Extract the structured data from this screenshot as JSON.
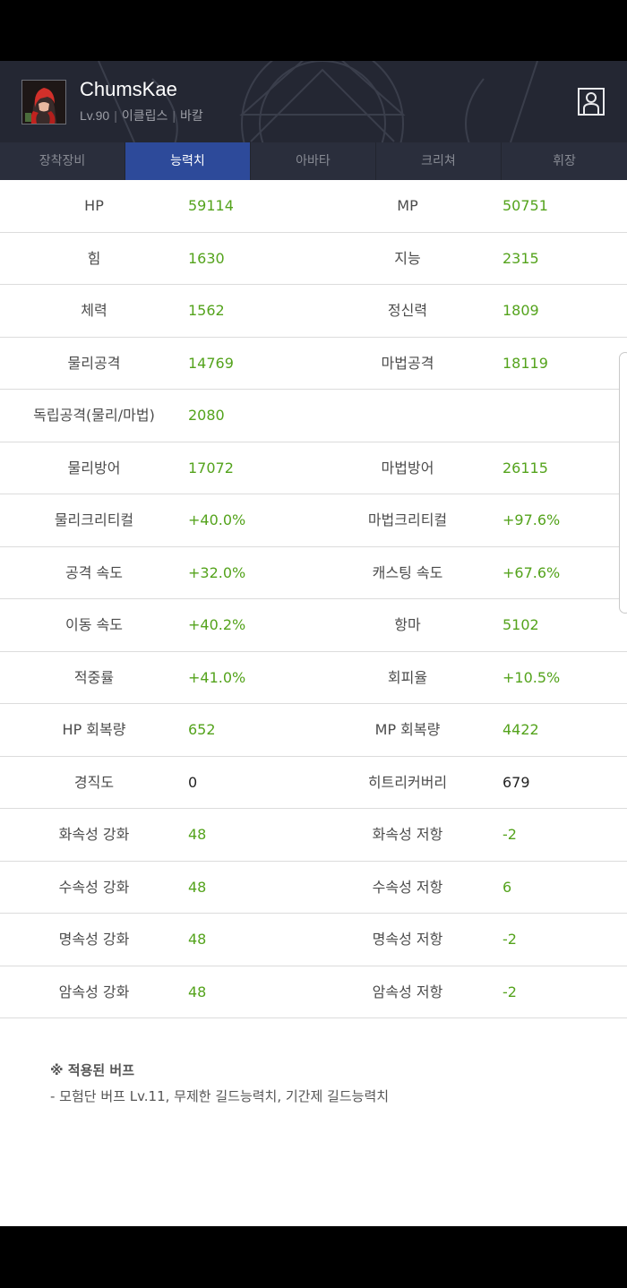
{
  "character": {
    "name": "ChumsKae",
    "level": "Lv.90",
    "job": "이클립스",
    "server": "바칼",
    "separator": "|"
  },
  "tabs": [
    {
      "label": "장착장비",
      "active": false
    },
    {
      "label": "능력치",
      "active": true
    },
    {
      "label": "아바타",
      "active": false
    },
    {
      "label": "크리쳐",
      "active": false
    },
    {
      "label": "휘장",
      "active": false
    }
  ],
  "stats": [
    {
      "left_label": "HP",
      "left_value": "59114",
      "right_label": "MP",
      "right_value": "50751"
    },
    {
      "left_label": "힘",
      "left_value": "1630",
      "right_label": "지능",
      "right_value": "2315"
    },
    {
      "left_label": "체력",
      "left_value": "1562",
      "right_label": "정신력",
      "right_value": "1809"
    },
    {
      "left_label": "물리공격",
      "left_value": "14769",
      "right_label": "마법공격",
      "right_value": "18119"
    },
    {
      "left_label": "독립공격(물리/마법)",
      "left_value": "2080",
      "right_label": "",
      "right_value": ""
    },
    {
      "left_label": "물리방어",
      "left_value": "17072",
      "right_label": "마법방어",
      "right_value": "26115"
    },
    {
      "left_label": "물리크리티컬",
      "left_value": "+40.0%",
      "right_label": "마법크리티컬",
      "right_value": "+97.6%"
    },
    {
      "left_label": "공격 속도",
      "left_value": "+32.0%",
      "right_label": "캐스팅 속도",
      "right_value": "+67.6%"
    },
    {
      "left_label": "이동 속도",
      "left_value": "+40.2%",
      "right_label": "항마",
      "right_value": "5102"
    },
    {
      "left_label": "적중률",
      "left_value": "+41.0%",
      "right_label": "회피율",
      "right_value": "+10.5%"
    },
    {
      "left_label": "HP 회복량",
      "left_value": "652",
      "right_label": "MP 회복량",
      "right_value": "4422"
    },
    {
      "left_label": "경직도",
      "left_value": "0",
      "right_label": "히트리커버리",
      "right_value": "679",
      "neutral": true
    },
    {
      "left_label": "화속성 강화",
      "left_value": "48",
      "right_label": "화속성 저항",
      "right_value": "-2"
    },
    {
      "left_label": "수속성 강화",
      "left_value": "48",
      "right_label": "수속성 저항",
      "right_value": "6"
    },
    {
      "left_label": "명속성 강화",
      "left_value": "48",
      "right_label": "명속성 저항",
      "right_value": "-2"
    },
    {
      "left_label": "암속성 강화",
      "left_value": "48",
      "right_label": "암속성 저항",
      "right_value": "-2"
    }
  ],
  "buff_note": {
    "title": "※ 적용된 버프",
    "text": "- 모험단 버프 Lv.11, 무제한 길드능력치, 기간제 길드능력치"
  },
  "colors": {
    "stat_value": "#54a31c",
    "tab_active_bg": "#2d4a9a",
    "header_bg": "#242733"
  },
  "icons": {
    "profile": "person-outline-icon"
  }
}
